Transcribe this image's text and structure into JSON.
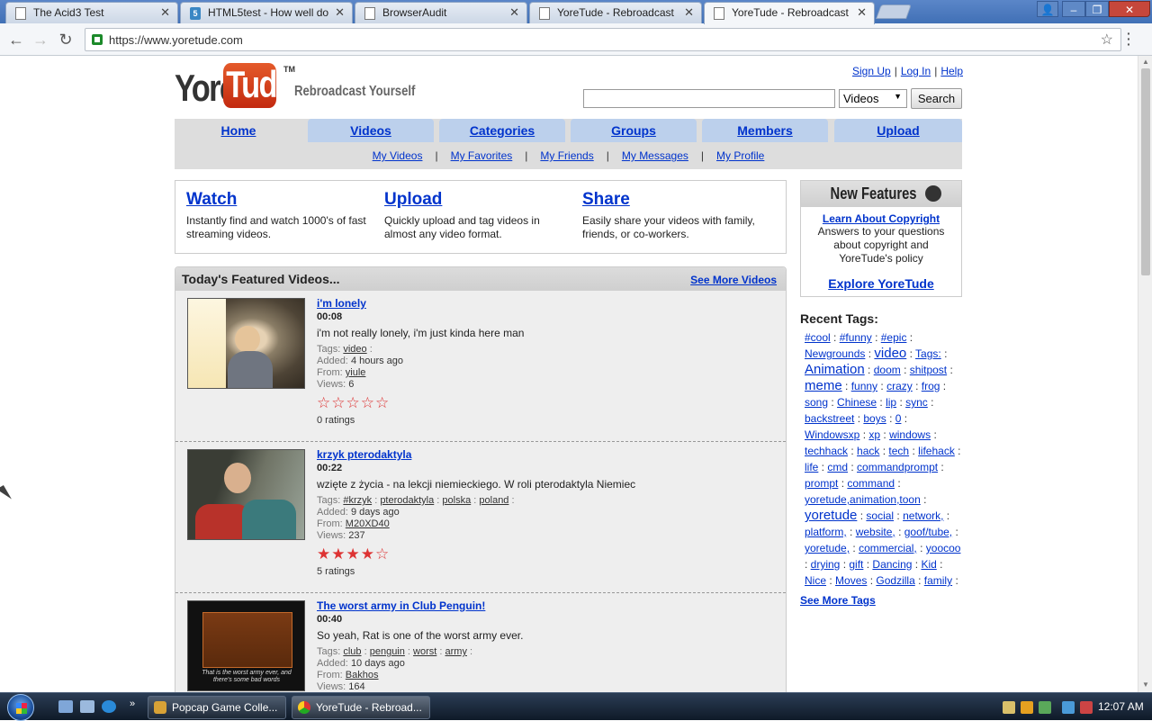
{
  "browser": {
    "tabs": [
      {
        "title": "The Acid3 Test",
        "icon": "page-icon"
      },
      {
        "title": "HTML5test - How well do",
        "icon": "html5-icon"
      },
      {
        "title": "BrowserAudit",
        "icon": "page-icon"
      },
      {
        "title": "YoreTude - Rebroadcast",
        "icon": "page-icon"
      },
      {
        "title": "YoreTude - Rebroadcast",
        "icon": "page-icon",
        "active": true
      }
    ],
    "url": "https://www.yoretude.com"
  },
  "site": {
    "logo_yore": "Yore",
    "logo_tube": "Tude",
    "logo_tm": "TM",
    "tagline": "Rebroadcast Yourself",
    "user_links": [
      "Sign Up",
      "Log In",
      "Help"
    ],
    "search": {
      "value": "",
      "category": "Videos",
      "button": "Search"
    },
    "nav_tabs": [
      "Home",
      "Videos",
      "Categories",
      "Groups",
      "Members",
      "Upload"
    ],
    "sub_nav": [
      "My Videos",
      "My Favorites",
      "My Friends",
      "My Messages",
      "My Profile"
    ],
    "intro": [
      {
        "title": "Watch",
        "desc": "Instantly find and watch 1000's of fast streaming videos."
      },
      {
        "title": "Upload",
        "desc": "Quickly upload and tag videos in almost any video format."
      },
      {
        "title": "Share",
        "desc": "Easily share your videos with family, friends, or co-workers."
      }
    ],
    "featured": {
      "title": "Today's Featured Videos...",
      "see_more": "See More Videos",
      "labels": {
        "tags": "Tags:",
        "added": "Added:",
        "from": "From:",
        "views": "Views:"
      },
      "videos": [
        {
          "title": "i'm lonely",
          "duration": "00:08",
          "desc": "i'm not really lonely, i'm just kinda here man",
          "tags": [
            "video"
          ],
          "added": "4 hours ago",
          "from": "yiule",
          "views": "6",
          "rating": 0,
          "ratings_text": "0 ratings"
        },
        {
          "title": "krzyk pterodaktyla",
          "duration": "00:22",
          "desc": "wzięte z życia - na lekcji niemieckiego. W roli pterodaktyla Niemiec",
          "tags": [
            "#krzyk",
            "pterodaktyla",
            "polska",
            "poland"
          ],
          "added": "9 days ago",
          "from": "M20XD40",
          "views": "237",
          "rating": 4,
          "ratings_text": "5 ratings"
        },
        {
          "title": "The worst army in Club Penguin!",
          "duration": "00:40",
          "desc": "So yeah, Rat is one of the worst army ever.",
          "tags": [
            "club",
            "penguin",
            "worst",
            "army"
          ],
          "added": "10 days ago",
          "from": "Bakhos",
          "views": "164",
          "rating": 0,
          "ratings_text": "",
          "thumb_caption": "That is the worst army ever, and there's some bad words"
        }
      ]
    },
    "new_features": {
      "title": "New Features",
      "link": "Learn About Copyright",
      "desc": "Answers to your questions about copyright and YoreTude's policy",
      "explore": "Explore YoreTude"
    },
    "recent_tags": {
      "title": "Recent Tags:",
      "tags": [
        {
          "t": "#cool"
        },
        {
          "t": "#funny"
        },
        {
          "t": "#epic"
        },
        {
          "t": "Newgrounds"
        },
        {
          "t": "video",
          "big": true
        },
        {
          "t": "Tags:"
        },
        {
          "t": "Animation",
          "big": true
        },
        {
          "t": "doom"
        },
        {
          "t": "shitpost"
        },
        {
          "t": "meme",
          "big": true
        },
        {
          "t": "funny"
        },
        {
          "t": "crazy"
        },
        {
          "t": "frog"
        },
        {
          "t": "song"
        },
        {
          "t": "Chinese"
        },
        {
          "t": "lip"
        },
        {
          "t": "sync"
        },
        {
          "t": "backstreet"
        },
        {
          "t": "boys"
        },
        {
          "t": "0"
        },
        {
          "t": "Windowsxp"
        },
        {
          "t": "xp"
        },
        {
          "t": "windows"
        },
        {
          "t": "techhack"
        },
        {
          "t": "hack"
        },
        {
          "t": "tech"
        },
        {
          "t": "lifehack"
        },
        {
          "t": "life"
        },
        {
          "t": "cmd"
        },
        {
          "t": "commandprompt"
        },
        {
          "t": "prompt"
        },
        {
          "t": "command"
        },
        {
          "t": "yoretude,animation,toon"
        },
        {
          "t": "yoretude",
          "big": true
        },
        {
          "t": "social"
        },
        {
          "t": "network,"
        },
        {
          "t": "platform,"
        },
        {
          "t": "website,"
        },
        {
          "t": "goof/tube,"
        },
        {
          "t": "yoretude,"
        },
        {
          "t": "commercial,"
        },
        {
          "t": "yoocoo"
        },
        {
          "t": "drying"
        },
        {
          "t": "gift"
        },
        {
          "t": "Dancing"
        },
        {
          "t": "Kid"
        },
        {
          "t": "Nice"
        },
        {
          "t": "Moves"
        },
        {
          "t": "Godzilla"
        },
        {
          "t": "family"
        }
      ],
      "see_more": "See More Tags"
    }
  },
  "taskbar": {
    "tasks": [
      {
        "label": "Popcap Game Colle..."
      },
      {
        "label": "YoreTude - Rebroad...",
        "active": true
      }
    ],
    "clock": "12:07 AM"
  }
}
